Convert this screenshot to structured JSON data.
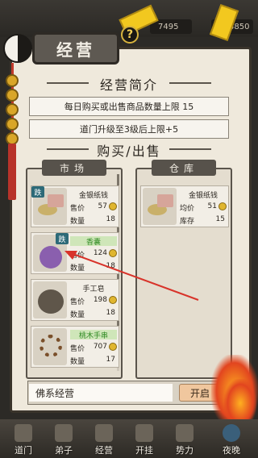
{
  "status_bar": {
    "resource_1": "7495",
    "resource_2": "3850",
    "help_label": "?"
  },
  "header": {
    "title": "经营"
  },
  "intro": {
    "title": "经营简介",
    "lines": [
      "每日购买或出售商品数量上限 15",
      "道门升级至3级后上限+5"
    ]
  },
  "trade": {
    "title": "购买/出售",
    "market_tab": "市场",
    "warehouse_tab": "仓库",
    "badge_down": "跌",
    "market_items": [
      {
        "name": "金银纸钱",
        "price_label": "售价",
        "price": "57",
        "qty_label": "数量",
        "qty": "18",
        "highlight": false
      },
      {
        "name": "香囊",
        "price_label": "售价",
        "price": "124",
        "qty_label": "数量",
        "qty": "18",
        "highlight": true
      },
      {
        "name": "手工皂",
        "price_label": "售价",
        "price": "198",
        "qty_label": "数量",
        "qty": "18",
        "highlight": false
      },
      {
        "name": "桃木手串",
        "price_label": "售价",
        "price": "707",
        "qty_label": "数量",
        "qty": "17",
        "highlight": true
      }
    ],
    "warehouse_items": [
      {
        "name": "金银纸钱",
        "price_label": "均价",
        "price": "51",
        "qty_label": "库存",
        "qty": "15"
      }
    ]
  },
  "shop_bar": {
    "shop_name": "佛系经营",
    "open_button": "开启"
  },
  "bottom_nav": [
    {
      "label": "道门",
      "icon": "temple-icon"
    },
    {
      "label": "弟子",
      "icon": "disciple-icon"
    },
    {
      "label": "经营",
      "icon": "shop-icon"
    },
    {
      "label": "开挂",
      "icon": "power-icon"
    },
    {
      "label": "势力",
      "icon": "faction-icon"
    },
    {
      "label": "夜晚",
      "icon": "night-icon"
    }
  ],
  "colors": {
    "accent_red": "#d8332a",
    "badge_teal": "#2d6a78",
    "highlight_green": "#2f8a23",
    "gold": "#e0b62f"
  }
}
